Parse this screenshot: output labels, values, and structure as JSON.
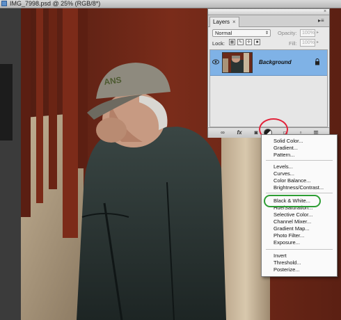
{
  "document": {
    "title": "IMG_7998.psd @ 25% (RGB/8*)"
  },
  "layers_panel": {
    "tab_label": "Layers",
    "tab_close": "×",
    "panel_close": "×",
    "panel_menu": "▸≡",
    "blend_mode": "Normal",
    "opacity_label": "Opacity:",
    "opacity_value": "100%",
    "lock_label": "Lock:",
    "fill_label": "Fill:",
    "fill_value": "100%",
    "layers": [
      {
        "name": "Background",
        "visible": true,
        "locked": true,
        "selected": true
      }
    ],
    "footer_buttons": [
      "link-icon",
      "fx-icon",
      "mask-icon",
      "adjustment-icon",
      "folder-icon",
      "new-layer-icon",
      "trash-icon"
    ]
  },
  "adjustment_menu": {
    "items": [
      "Solid Color...",
      "Gradient...",
      "Pattern...",
      "Levels...",
      "Curves...",
      "Color Balance...",
      "Brightness/Contrast...",
      "Black & White...",
      "Hue/Saturation...",
      "Selective Color...",
      "Channel Mixer...",
      "Gradient Map...",
      "Photo Filter...",
      "Exposure...",
      "Invert",
      "Threshold...",
      "Posterize..."
    ],
    "highlighted_item": "Black & White..."
  },
  "colors": {
    "selected_layer": "#7fb2e6",
    "red_highlight": "#e2233a",
    "green_highlight": "#2e9e34"
  }
}
